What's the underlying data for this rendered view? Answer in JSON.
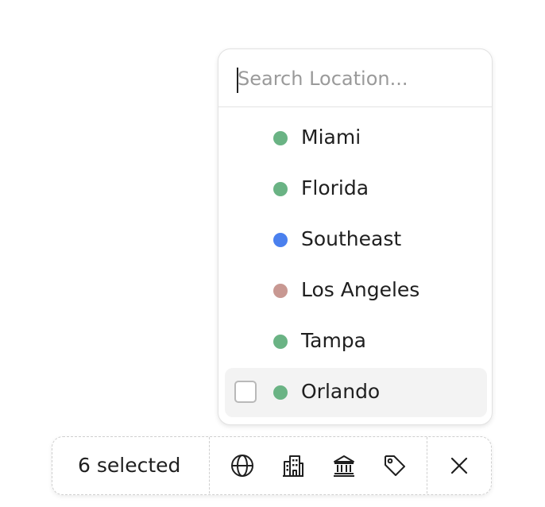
{
  "search": {
    "placeholder": "Search Location...",
    "value": ""
  },
  "locations": [
    {
      "label": "Miami",
      "color": "#6ab384"
    },
    {
      "label": "Florida",
      "color": "#6ab384"
    },
    {
      "label": "Southeast",
      "color": "#4a80ee"
    },
    {
      "label": "Los Angeles",
      "color": "#c89892"
    },
    {
      "label": "Tampa",
      "color": "#6ab384"
    },
    {
      "label": "Orlando",
      "color": "#6ab384",
      "highlighted": true,
      "checked": false
    }
  ],
  "selection_bar": {
    "count_label": "6 selected",
    "actions": [
      {
        "icon": "globe-icon"
      },
      {
        "icon": "building-icon"
      },
      {
        "icon": "bank-icon"
      },
      {
        "icon": "tag-icon"
      }
    ],
    "close_icon": "close-icon"
  }
}
